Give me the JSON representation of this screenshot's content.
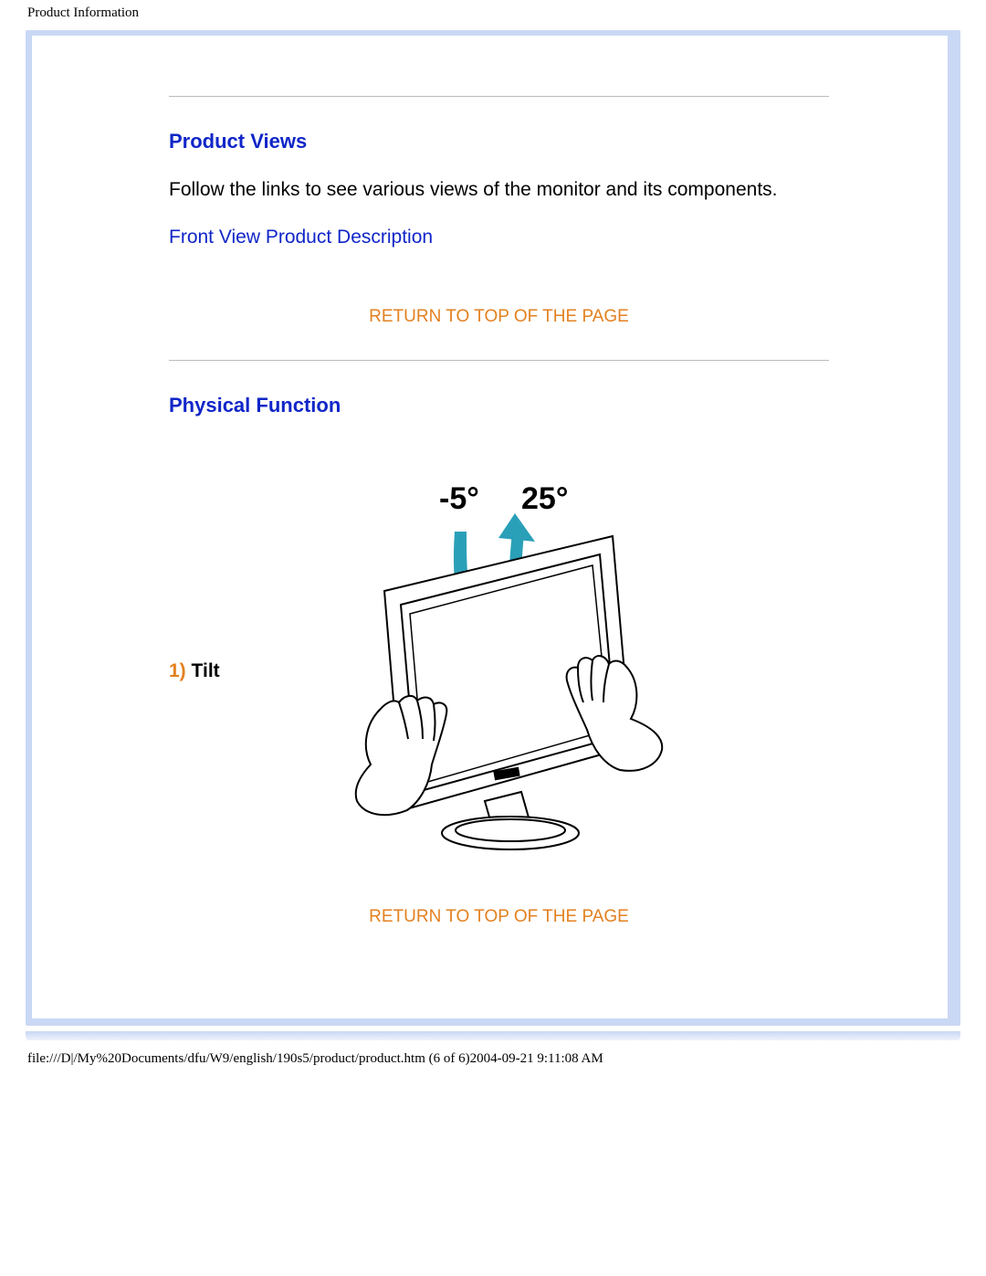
{
  "header": {
    "title": "Product Information"
  },
  "sections": {
    "product_views": {
      "heading": "Product Views",
      "body": "Follow the links to see various views of the monitor and its components.",
      "link_label": "Front View Product Description"
    },
    "physical_function": {
      "heading": "Physical Function",
      "item_number": "1)",
      "item_label": "Tilt",
      "angles": {
        "min": "-5°",
        "max": "25°"
      }
    },
    "return_link_label": "RETURN TO TOP OF THE PAGE"
  },
  "footer": {
    "path": "file:///D|/My%20Documents/dfu/W9/english/190s5/product/product.htm (6 of 6)2004-09-21 9:11:08 AM"
  }
}
